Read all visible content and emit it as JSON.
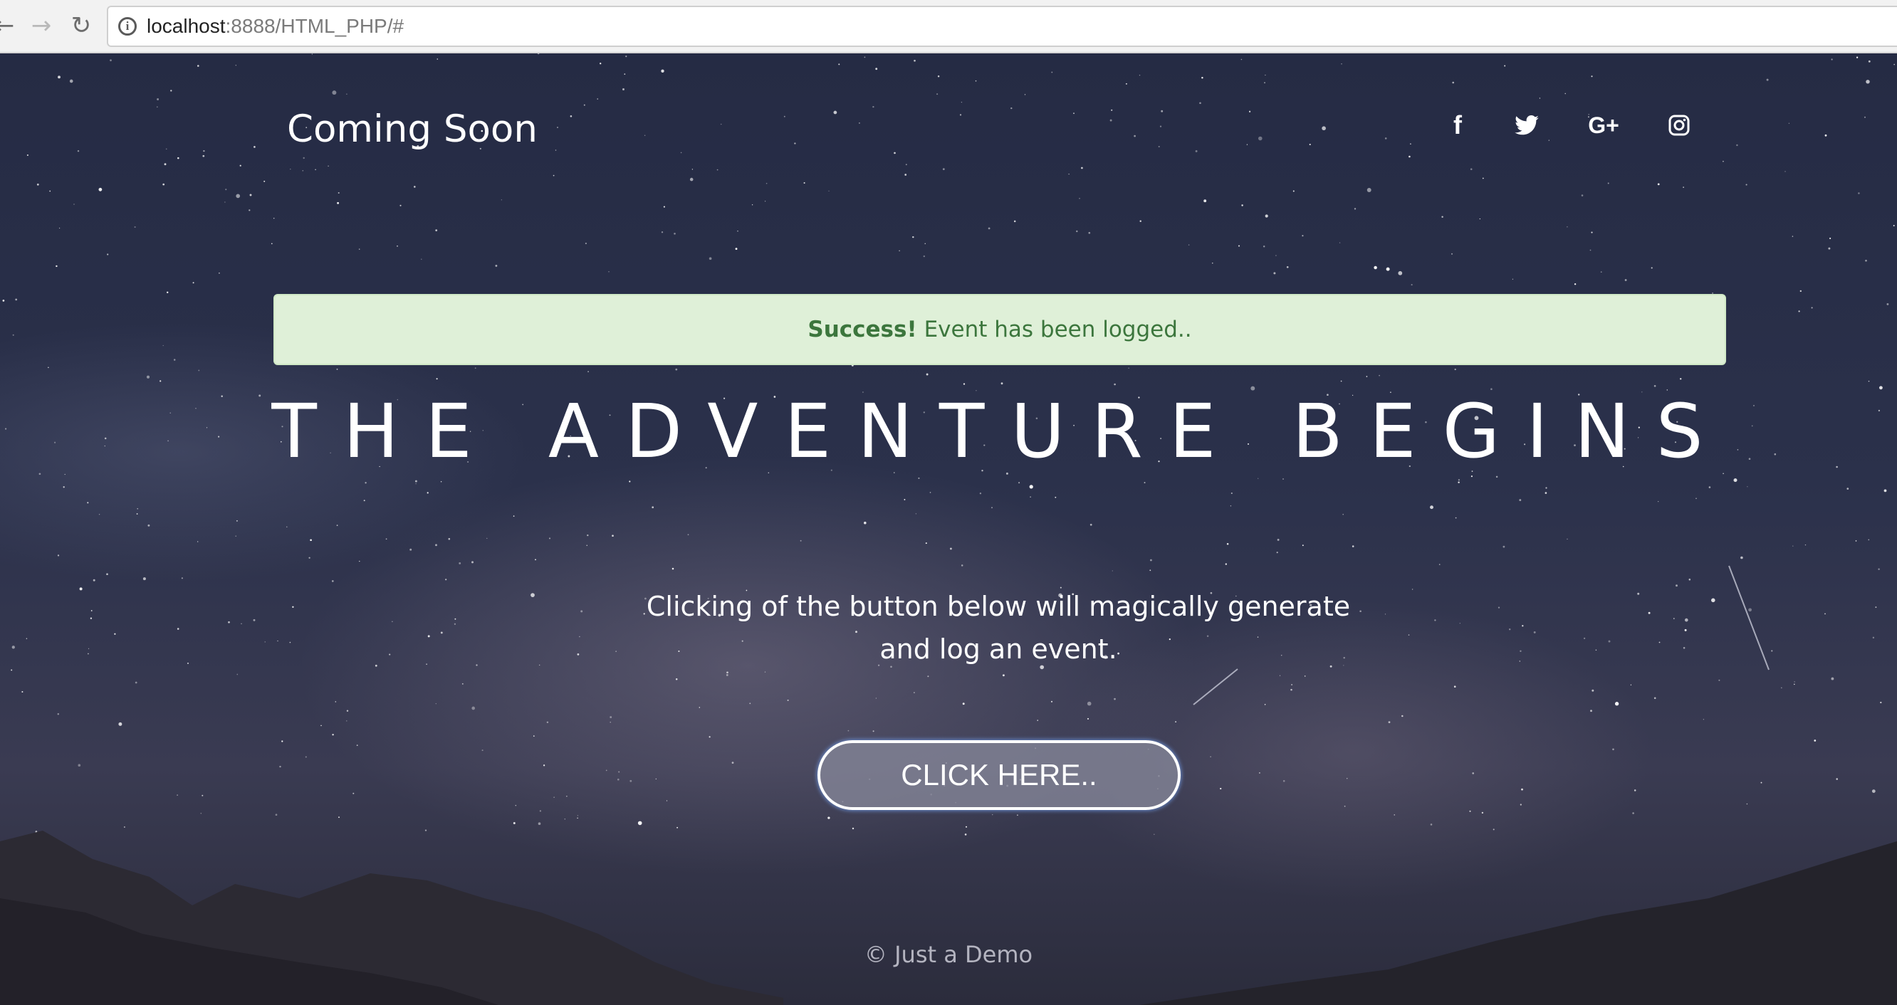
{
  "browser": {
    "back_icon": "arrow-left-icon",
    "forward_icon": "arrow-right-icon",
    "reload_icon": "reload-icon",
    "info_icon": "info-icon",
    "url_host": "localhost",
    "url_rest": ":8888/HTML_PHP/#"
  },
  "header": {
    "brand": "Coming Soon",
    "social": [
      {
        "name": "facebook",
        "icon": "facebook-icon",
        "glyph": "f"
      },
      {
        "name": "twitter",
        "icon": "twitter-icon"
      },
      {
        "name": "google-plus",
        "icon": "google-plus-icon",
        "glyph": "G+"
      },
      {
        "name": "instagram",
        "icon": "instagram-icon"
      }
    ]
  },
  "alert": {
    "strong": "Success!",
    "message": "Event has been logged..",
    "background": "#dff0d8",
    "text_color": "#3c763d"
  },
  "hero": {
    "headline": "THE ADVENTURE BEGINS",
    "description_line1": "Clicking of the button below will magically generate",
    "description_line2": "and log an event.",
    "button_label": "CLICK HERE.."
  },
  "footer": {
    "text": "© Just a Demo"
  }
}
